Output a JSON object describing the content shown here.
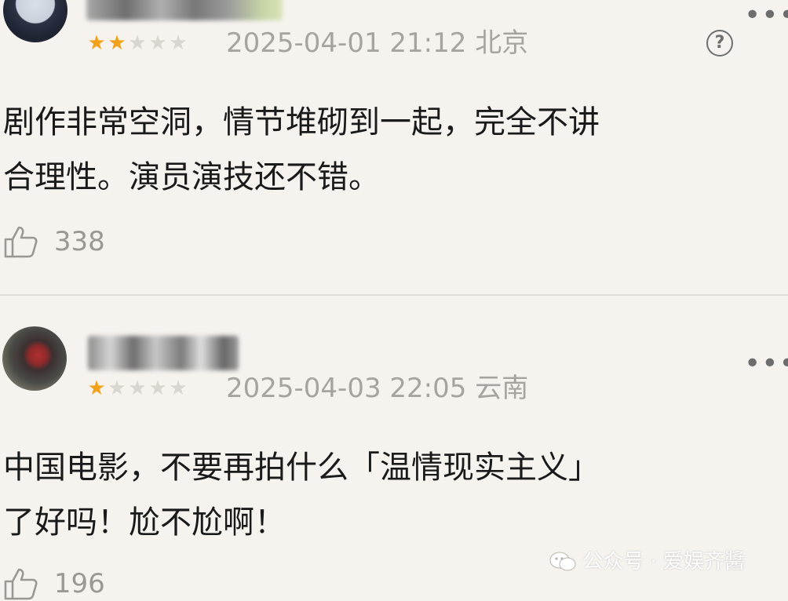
{
  "comments": [
    {
      "rating": 2,
      "max_rating": 5,
      "datetime_location": "2025-04-01 21:12 北京",
      "text_lines": [
        "剧作非常空洞，情节堆砌到一起，完全不讲",
        "合理性。演员演技还不错。"
      ],
      "likes": "338",
      "icons": {
        "avatar": "avatar-icon",
        "star": "star-icon",
        "help": "question-circle-icon",
        "like": "thumbs-up-icon"
      }
    },
    {
      "rating": 1,
      "max_rating": 5,
      "datetime_location": "2025-04-03 22:05 云南",
      "text_lines": [
        "中国电影，不要再拍什么「温情现实主义」",
        "了好吗！尬不尬啊！"
      ],
      "likes": "196",
      "icons": {
        "avatar": "avatar-icon",
        "star": "star-icon",
        "more": "more-dots-icon",
        "like": "thumbs-up-icon"
      }
    }
  ],
  "first_comment_more": "•••",
  "second_comment_more": "•••",
  "help_symbol": "?",
  "watermark": {
    "text": "公众号 · 爱娱齐醬",
    "icon": "wechat-icon"
  },
  "colors": {
    "star_on": "#f2a11a",
    "star_off": "#d9d6d0",
    "meta": "#a7a4a0",
    "background": "#f6f3ef"
  }
}
